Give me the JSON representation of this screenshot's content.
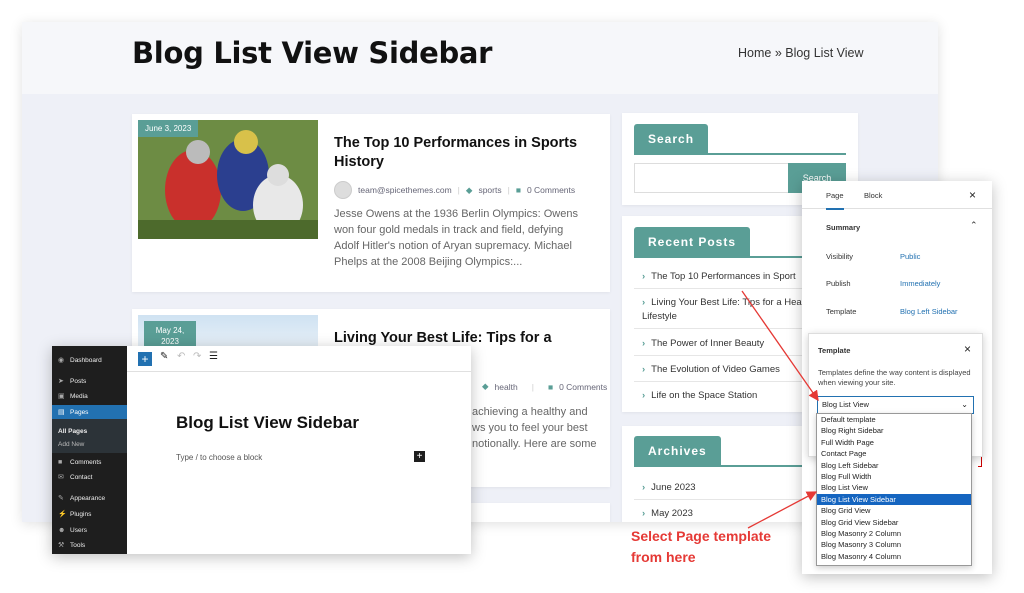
{
  "blog": {
    "page_title": "Blog List View Sidebar",
    "breadcrumb": "Home » Blog List View",
    "posts": [
      {
        "date": "June 3, 2023",
        "title": "The Top 10 Performances in Sports History",
        "author": "team@spicethemes.com",
        "category": "sports",
        "comments": "0 Comments",
        "excerpt": "Jesse Owens at the 1936 Berlin Olympics: Owens won four gold medals in track and field, defying Adolf Hitler's notion of Aryan supremacy. Michael Phelps at the 2008 Beijing Olympics:..."
      },
      {
        "date": "May 24, 2023",
        "title": "Living Your Best Life: Tips for a Healthy",
        "category": "health",
        "comments": "0 Comments",
        "excerpt_lines": [
          "achieving a healthy and",
          "ws you to feel your best",
          "notionally. Here are some"
        ]
      }
    ],
    "search": {
      "title": "Search",
      "button": "Search"
    },
    "recent_posts": {
      "title": "Recent Posts",
      "items": [
        "The Top 10 Performances in Sport",
        "Living Your Best Life: Tips for a Hea",
        "Lifestyle",
        "The Power of Inner Beauty",
        "The Evolution of Video Games",
        "Life on the Space Station"
      ]
    },
    "archives": {
      "title": "Archives",
      "items": [
        "June 2023",
        "May 2023"
      ]
    }
  },
  "editor": {
    "sidebar": [
      "Dashboard",
      "Posts",
      "Media",
      "Pages",
      "All Pages",
      "Add New",
      "Comments",
      "Contact",
      "Appearance",
      "Plugins",
      "Users",
      "Tools"
    ],
    "doc_title": "Blog List View Sidebar",
    "placeholder": "Type / to choose a block",
    "add_block": "+"
  },
  "panel": {
    "tab_page": "Page",
    "tab_block": "Block",
    "close": "×",
    "summary": "Summary",
    "rows": [
      {
        "label": "Visibility",
        "value": "Public"
      },
      {
        "label": "Publish",
        "value": "Immediately"
      },
      {
        "label": "Template",
        "value": "Blog Left Sidebar"
      }
    ],
    "template_box": {
      "title": "Template",
      "description": "Templates define the way content is displayed when viewing your site.",
      "selected": "Blog List View",
      "options": [
        "Default template",
        "Blog Right Sidebar",
        "Full Width Page",
        "Contact Page",
        "Blog Left Sidebar",
        "Blog Full Width",
        "Blog List View",
        "Blog List View Sidebar",
        "Blog Grid View",
        "Blog Grid View Sidebar",
        "Blog Masonry 2 Column",
        "Blog Masonry 3 Column",
        "Blog Masonry 4 Column"
      ],
      "highlighted": "Blog List View Sidebar"
    }
  },
  "annotation": {
    "line1": "Select Page template",
    "line2": "from here",
    "color": "#e53935"
  },
  "colors": {
    "accent": "#5a9e96",
    "wp_blue": "#2271b1",
    "select_blue": "#1565c0"
  }
}
